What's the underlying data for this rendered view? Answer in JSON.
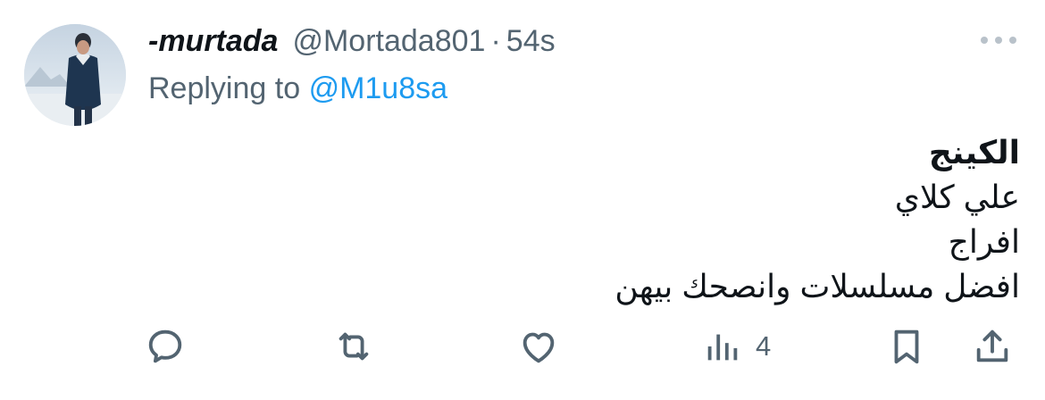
{
  "tweet": {
    "display_name": "-murtada",
    "handle": "@Mortada801",
    "separator": "·",
    "time": "54s",
    "replying_prefix": "Replying to",
    "replying_to": "@M1u8sa",
    "body_lines": [
      "الكينج",
      "علي كلاي",
      "افراج",
      "افضل مسلسلات وانصحك بيهن"
    ]
  },
  "actions": {
    "reply_icon": "reply-icon",
    "retweet_icon": "retweet-icon",
    "like_icon": "heart-icon",
    "views_icon": "views-icon",
    "views_count": "4",
    "bookmark_icon": "bookmark-icon",
    "share_icon": "share-icon"
  },
  "colors": {
    "text_primary": "#0f1419",
    "text_secondary": "#536471",
    "link": "#1d9bf0",
    "background": "#ffffff"
  }
}
